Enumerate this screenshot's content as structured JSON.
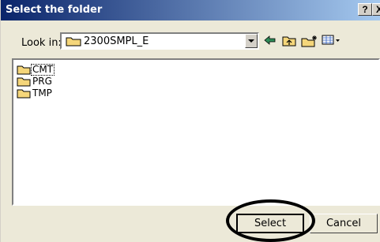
{
  "window": {
    "title": "Select the folder",
    "help_label": "?",
    "close_label": "X"
  },
  "lookin": {
    "label": "Look in:",
    "value": "2300SMPL_E"
  },
  "toolbar": {
    "icons": [
      "back-icon",
      "up-folder-icon",
      "new-folder-icon",
      "view-menu-icon"
    ]
  },
  "folders": [
    {
      "name": "CMT",
      "focused": true
    },
    {
      "name": "PRG",
      "focused": false
    },
    {
      "name": "TMP",
      "focused": false
    }
  ],
  "buttons": {
    "select_label": "Select",
    "cancel_label": "Cancel"
  },
  "colors": {
    "title_start": "#0a246a",
    "title_end": "#a6caf0",
    "folder": "#f5d67a",
    "dialog_bg": "#ece9d8"
  }
}
